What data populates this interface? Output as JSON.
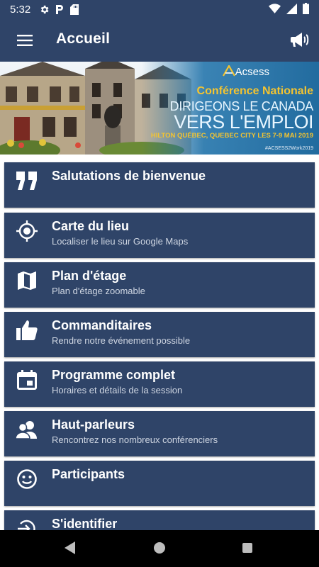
{
  "status_bar": {
    "time": "5:32",
    "left_icons": [
      "gear-icon",
      "parking-icon",
      "sd-card-icon"
    ],
    "right_icons": [
      "wifi-icon",
      "signal-icon",
      "battery-icon"
    ]
  },
  "app_bar": {
    "title": "Accueil",
    "menu_icon": "hamburger-icon",
    "action_icon": "megaphone-icon"
  },
  "banner": {
    "logo_text": "Acsess",
    "conference": "Conférence Nationale",
    "headline_1": "DIRIGEONS LE CANADA",
    "headline_2": "VERS L'EMPLOI",
    "venue": "HILTON QUÉBEC, QUEBEC CITY   LES 7-9 MAI 2019",
    "hashtag": "#ACSESS2Work2019"
  },
  "menu_items": [
    {
      "title": "Salutations de bienvenue",
      "subtitle": "",
      "icon": "quote-icon"
    },
    {
      "title": "Carte du lieu",
      "subtitle": "Localiser le lieu sur Google Maps",
      "icon": "location-target-icon"
    },
    {
      "title": "Plan d'étage",
      "subtitle": "Plan d'étage zoomable",
      "icon": "map-icon"
    },
    {
      "title": "Commanditaires",
      "subtitle": "Rendre notre événement possible",
      "icon": "thumbs-up-icon"
    },
    {
      "title": "Programme complet",
      "subtitle": "Horaires et détails de la session",
      "icon": "calendar-icon"
    },
    {
      "title": "Haut-parleurs",
      "subtitle": "Rencontrez nos nombreux conférenciers",
      "icon": "people-icon"
    },
    {
      "title": "Participants",
      "subtitle": "",
      "icon": "smiley-icon"
    },
    {
      "title": "S'identifier",
      "subtitle": "",
      "icon": "login-icon"
    }
  ],
  "colors": {
    "primary": "#2f4468",
    "banner_accent": "#f4c430",
    "card_text": "#ffffff",
    "subtitle_text": "#cfd6e2"
  }
}
